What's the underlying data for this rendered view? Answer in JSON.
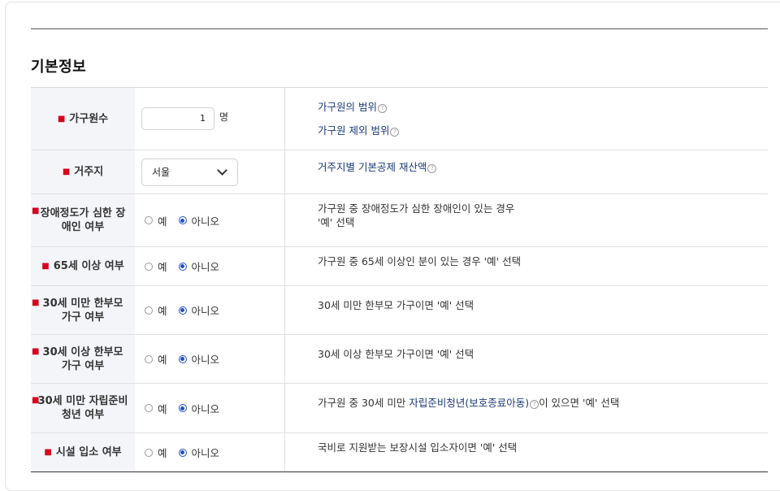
{
  "section_title": "기본정보",
  "colors": {
    "required": "#d6001c",
    "accent": "#1f4fd1",
    "link": "#1d3a7a"
  },
  "fields": {
    "household": {
      "label": "가구원수",
      "value": "1",
      "unit": "명",
      "desc_line1": "가구원의 범위",
      "desc_line2": "가구원 제외 범위"
    },
    "residence": {
      "label": "거주지",
      "selected": "서울",
      "desc_line1": "거주지별 기본공제 재산액"
    }
  },
  "radio_rows": [
    {
      "label_line1": "장애정도가 심한 장",
      "label_line2": "애인 여부",
      "yes": "예",
      "no": "아니오",
      "selected": "no",
      "desc_line1": "가구원 중 장애정도가 심한 장애인이 있는 경우",
      "desc_line2": "'예' 선택"
    },
    {
      "label_line1": "65세 이상 여부",
      "label_line2": "",
      "yes": "예",
      "no": "아니오",
      "selected": "no",
      "desc_line1": "가구원 중 65세 이상인 분이 있는 경우 '예' 선택",
      "desc_line2": ""
    },
    {
      "label_line1": "30세 미만 한부모",
      "label_line2": "가구 여부",
      "yes": "예",
      "no": "아니오",
      "selected": "no",
      "desc_line1": "30세 미만 한부모 가구이면 '예' 선택",
      "desc_line2": ""
    },
    {
      "label_line1": "30세 이상 한부모",
      "label_line2": "가구 여부",
      "yes": "예",
      "no": "아니오",
      "selected": "no",
      "desc_line1": "30세 이상 한부모 가구이면 '예' 선택",
      "desc_line2": ""
    },
    {
      "label_line1": "30세 미만 자립준비",
      "label_line2": "청년 여부",
      "yes": "예",
      "no": "아니오",
      "selected": "no",
      "desc_prefix": "가구원 중 30세 미만 ",
      "desc_link": "자립준비청년(보호종료아동)",
      "desc_suffix": "이 있으면 '예' 선택"
    },
    {
      "label_line1": "시설 입소 여부",
      "label_line2": "",
      "yes": "예",
      "no": "아니오",
      "selected": "no",
      "desc_line1": "국비로 지원받는 보장시설 입소자이면 '예' 선택",
      "desc_line2": ""
    }
  ]
}
